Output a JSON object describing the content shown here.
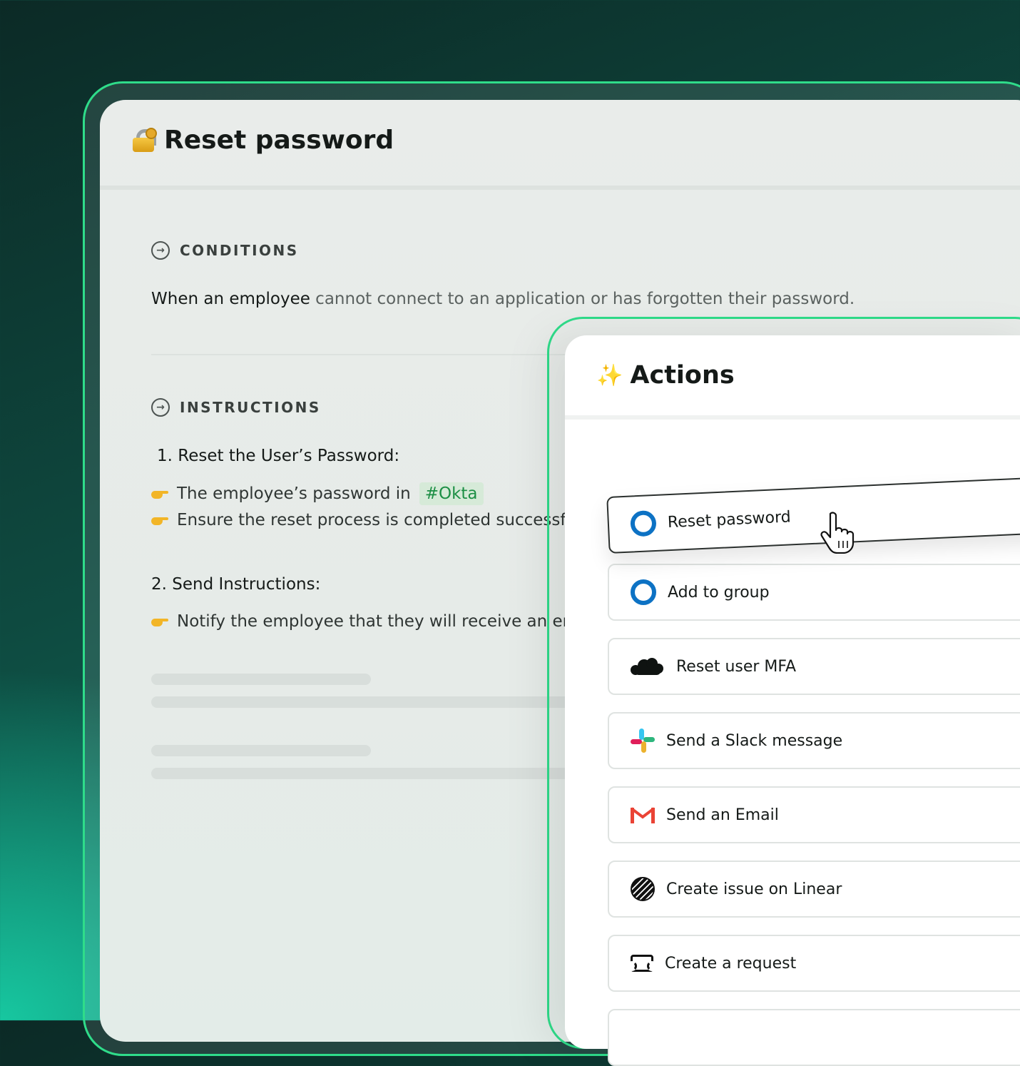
{
  "main": {
    "title": "Reset password",
    "title_icon": "locked-with-key-icon",
    "conditions": {
      "heading": "CONDITIONS",
      "text_bold": "When an employee",
      "text_rest": " cannot connect to an application or has forgotten their password."
    },
    "instructions": {
      "heading": "INSTRUCTIONS",
      "steps": [
        {
          "title": "1. Reset the User’s Password:",
          "bullets": [
            {
              "prefix": "The employee’s password in ",
              "tag": "#Okta"
            },
            {
              "text": "Ensure the reset process is completed successful"
            }
          ]
        },
        {
          "title": "2. Send Instructions:",
          "bullets": [
            {
              "text": "Notify the employee that they will receive an ema"
            }
          ]
        }
      ]
    }
  },
  "actions": {
    "title": "Actions",
    "title_icon": "sparkles-icon",
    "items": [
      {
        "label": "Reset password",
        "icon": "okta-icon"
      },
      {
        "label": "Add to group",
        "icon": "okta-icon"
      },
      {
        "label": "Reset user MFA",
        "icon": "cloud-icon"
      },
      {
        "label": "Send a Slack message",
        "icon": "slack-icon"
      },
      {
        "label": "Send an Email",
        "icon": "gmail-icon"
      },
      {
        "label": "Create issue on Linear",
        "icon": "linear-icon"
      },
      {
        "label": "Create a request",
        "icon": "ticket-icon"
      }
    ]
  },
  "colors": {
    "accent_green": "#2fdc8a",
    "okta_blue": "#0d72c4",
    "tag_green": "#1d8f45"
  }
}
